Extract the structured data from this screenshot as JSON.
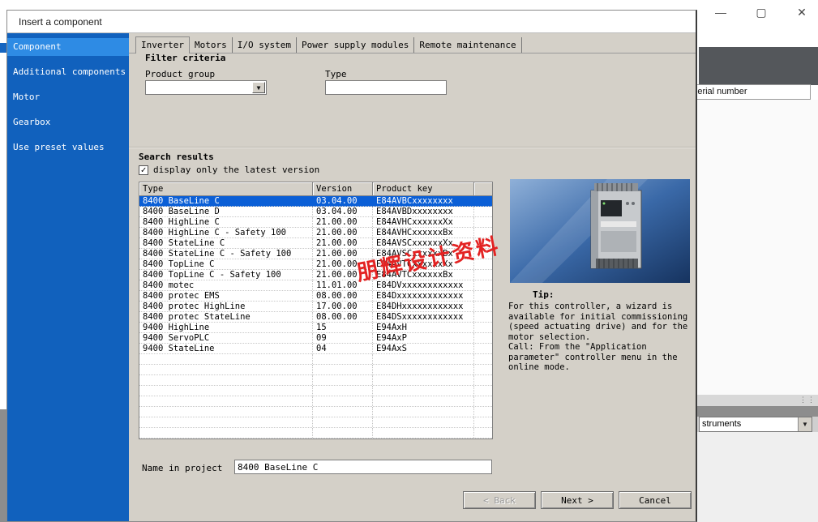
{
  "watermark": "朋辉设计资料",
  "background": {
    "window_controls": {
      "minimize": "—",
      "maximize": "▢",
      "close": "✕"
    },
    "serial_number_header": "Serial number",
    "combo_value": "struments",
    "grip": "⋮⋮"
  },
  "dialog": {
    "title": "Insert a component",
    "sidebar": {
      "items": [
        {
          "label": "Component",
          "active": true
        },
        {
          "label": "Additional components",
          "active": false
        },
        {
          "label": "Motor",
          "active": false
        },
        {
          "label": "Gearbox",
          "active": false
        },
        {
          "label": "Use preset values",
          "active": false
        }
      ]
    },
    "tabs": [
      {
        "label": "Inverter",
        "active": true
      },
      {
        "label": "Motors",
        "active": false
      },
      {
        "label": "I/O system",
        "active": false
      },
      {
        "label": "Power supply modules",
        "active": false
      },
      {
        "label": "Remote maintenance",
        "active": false
      }
    ],
    "filter": {
      "heading": "Filter criteria",
      "product_group": {
        "label": "Product group",
        "value": ""
      },
      "type": {
        "label": "Type",
        "value": ""
      }
    },
    "results": {
      "heading": "Search results",
      "latest_version_checkbox": {
        "label": "display only the latest version",
        "checked": true,
        "checkmark": "✓"
      },
      "columns": [
        "Type",
        "Version",
        "Product key",
        ""
      ],
      "selected_index": 0,
      "empty_row_count": 8,
      "rows": [
        [
          "8400 BaseLine C",
          "03.04.00",
          "E84AVBCxxxxxxxx"
        ],
        [
          "8400 BaseLine D",
          "03.04.00",
          "E84AVBDxxxxxxxx"
        ],
        [
          "8400 HighLine C",
          "21.00.00",
          "E84AVHCxxxxxxXx"
        ],
        [
          "8400 HighLine C - Safety 100",
          "21.00.00",
          "E84AVHCxxxxxxBx"
        ],
        [
          "8400 StateLine C",
          "21.00.00",
          "E84AVSCxxxxxxXx"
        ],
        [
          "8400 StateLine C - Safety 100",
          "21.00.00",
          "E84AVSCxxxxxxBx"
        ],
        [
          "8400 TopLine C",
          "21.00.00",
          "E84AVTCxxxxxxXx"
        ],
        [
          "8400 TopLine C - Safety 100",
          "21.00.00",
          "E84AVTCxxxxxxBx"
        ],
        [
          "8400 motec",
          "11.01.00",
          "E84DVxxxxxxxxxxxx"
        ],
        [
          "8400 protec EMS",
          "08.00.00",
          "E84Dxxxxxxxxxxxxx"
        ],
        [
          "8400 protec HighLine",
          "17.00.00",
          "E84DHxxxxxxxxxxxx"
        ],
        [
          "8400 protec StateLine",
          "08.00.00",
          "E84DSxxxxxxxxxxxx"
        ],
        [
          "9400 HighLine",
          "15",
          "E94AxH"
        ],
        [
          "9400 ServoPLC",
          "09",
          "E94AxP"
        ],
        [
          "9400 StateLine",
          "04",
          "E94AxS"
        ]
      ]
    },
    "tip": {
      "heading": "Tip:",
      "text": "For this controller, a wizard is\navailable for initial commissioning\n(speed actuating drive) and for the\nmotor selection.\nCall: From the \"Application\nparameter\" controller menu in the\nonline mode."
    },
    "name_in_project": {
      "label": "Name in project",
      "value": "8400 BaseLine C"
    },
    "buttons": [
      {
        "label": "< Back",
        "enabled": false,
        "name": "back-button"
      },
      {
        "label": "Next >",
        "enabled": true,
        "name": "next-button"
      },
      {
        "label": "Cancel",
        "enabled": true,
        "name": "cancel-button"
      }
    ]
  }
}
